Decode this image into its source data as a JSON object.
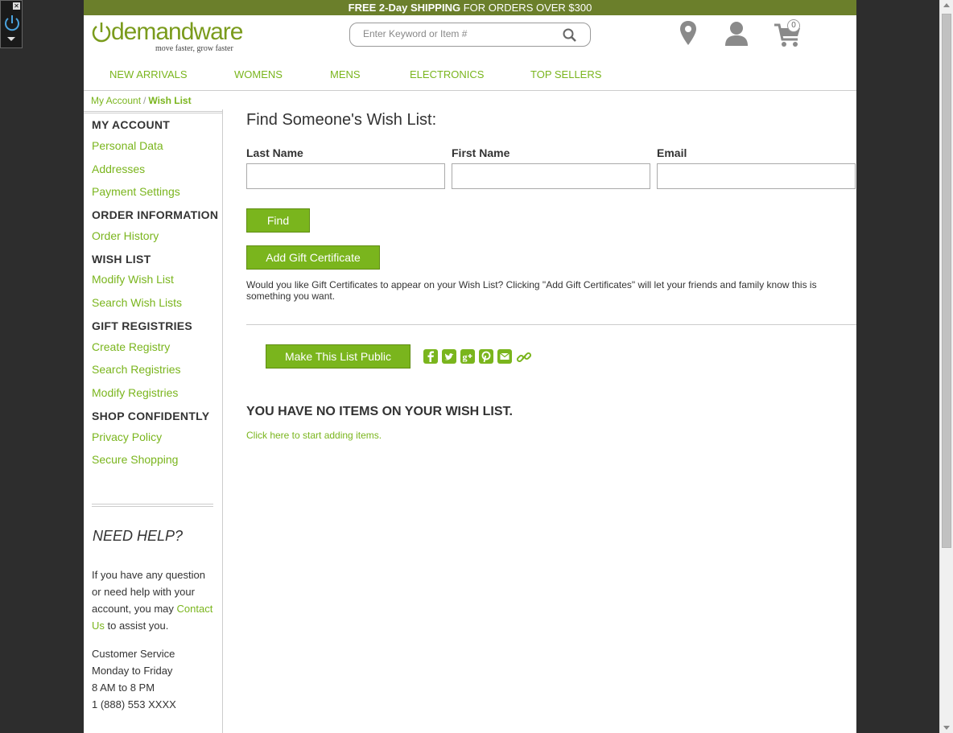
{
  "promo": {
    "bold1": "FREE 2-Day SHIPPING",
    "rest": " FOR ORDERS OVER $300"
  },
  "header": {
    "logo_text": "demandware",
    "logo_tagline": "move faster, grow faster",
    "search_placeholder": "Enter Keyword or Item #",
    "cart_count": "0"
  },
  "nav": [
    "NEW ARRIVALS",
    "WOMENS",
    "MENS",
    "ELECTRONICS",
    "TOP SELLERS"
  ],
  "breadcrumb": {
    "parent": "My Account",
    "separator": "/",
    "current": "Wish List"
  },
  "sidebar": {
    "sections": [
      {
        "heading": "MY ACCOUNT",
        "items": [
          "Personal Data",
          "Addresses",
          "Payment Settings"
        ]
      },
      {
        "heading": "ORDER INFORMATION",
        "items": [
          "Order History"
        ]
      },
      {
        "heading": "WISH LIST",
        "items": [
          "Modify Wish List",
          "Search Wish Lists"
        ]
      },
      {
        "heading": "GIFT REGISTRIES",
        "items": [
          "Create Registry",
          "Search Registries",
          "Modify Registries"
        ]
      },
      {
        "heading": "SHOP CONFIDENTLY",
        "items": [
          "Privacy Policy",
          "Secure Shopping"
        ]
      }
    ],
    "help_title": "NEED HELP?",
    "help_text_before": "If you have any question or need help with your account, you may ",
    "help_link": "Contact Us",
    "help_text_after": " to assist you.",
    "cs_lines": [
      "Customer Service",
      "Monday to Friday",
      "8 AM to 8 PM",
      "1 (888) 553 XXXX"
    ]
  },
  "main": {
    "title": "Find Someone's Wish List:",
    "labels": {
      "last_name": "Last Name",
      "first_name": "First Name",
      "email": "Email"
    },
    "find_button": "Find",
    "gift_button": "Add Gift Certificate",
    "gift_note": "Would you like Gift Certificates to appear on your Wish List? Clicking \"Add Gift Certificates\" will let your friends and family know this is something you want.",
    "public_button": "Make This List Public",
    "share_icons": [
      "facebook-icon",
      "twitter-icon",
      "google-plus-icon",
      "pinterest-icon",
      "email-icon",
      "link-icon"
    ],
    "empty_title": "YOU HAVE NO ITEMS ON YOUR WISH LIST.",
    "empty_link": "Click here to start adding items."
  },
  "colors": {
    "brand_green": "#7ab51d",
    "promo_bar": "#6b7f2b"
  }
}
